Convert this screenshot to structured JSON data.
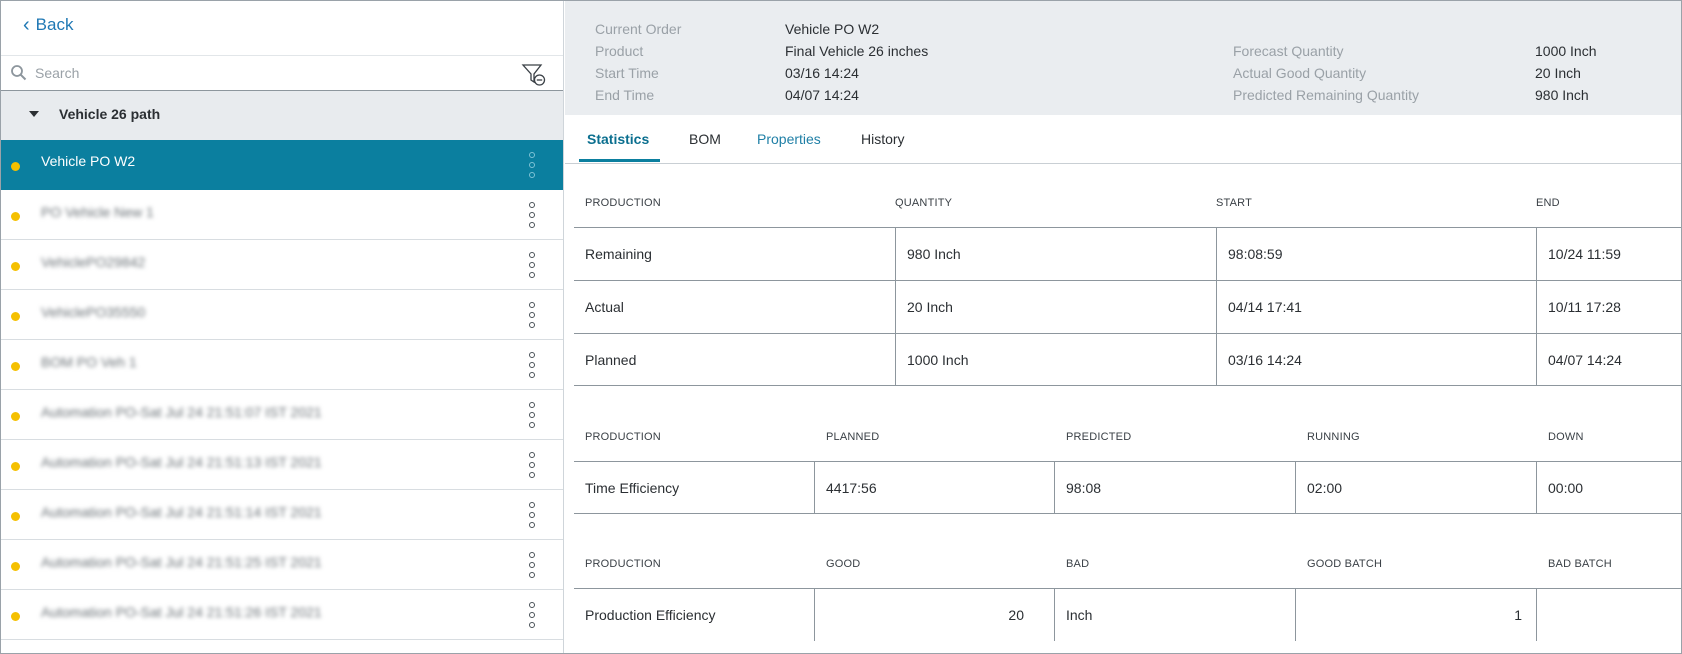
{
  "left_panel": {
    "back_label": "Back",
    "search_placeholder": "Search",
    "group_title": "Vehicle 26 path",
    "items": [
      {
        "label": "Vehicle PO W2",
        "active": true
      },
      {
        "label": "PO Vehicle New 1"
      },
      {
        "label": "VehiclePO29842"
      },
      {
        "label": "VehiclePO35550"
      },
      {
        "label": "BOM PO Veh 1"
      },
      {
        "label": "Automation PO-Sat Jul 24 21:51:07 IST 2021"
      },
      {
        "label": "Automation PO-Sat Jul 24 21:51:13 IST 2021"
      },
      {
        "label": "Automation PO-Sat Jul 24 21:51:14 IST 2021"
      },
      {
        "label": "Automation PO-Sat Jul 24 21:51:25 IST 2021"
      },
      {
        "label": "Automation PO-Sat Jul 24 21:51:26 IST 2021"
      }
    ]
  },
  "header": {
    "current_order_label": "Current Order",
    "current_order_value": "Vehicle PO W2",
    "product_label": "Product",
    "product_value": "Final Vehicle 26 inches",
    "start_time_label": "Start Time",
    "start_time_value": "03/16 14:24",
    "end_time_label": "End Time",
    "end_time_value": "04/07 14:24",
    "forecast_qty_label": "Forecast Quantity",
    "forecast_qty_value": "1000 Inch",
    "actual_good_qty_label": "Actual Good Quantity",
    "actual_good_qty_value": "20 Inch",
    "predicted_remaining_label": "Predicted Remaining Quantity",
    "predicted_remaining_value": "980 Inch"
  },
  "tabs": [
    "Statistics",
    "BOM",
    "Properties",
    "History"
  ],
  "quantity_table": {
    "headers": [
      "PRODUCTION",
      "QUANTITY",
      "START",
      "END"
    ],
    "rows": [
      [
        "Remaining",
        "980 Inch",
        "98:08:59",
        "10/24 11:59"
      ],
      [
        "Actual",
        "20 Inch",
        "04/14 17:41",
        "10/11 17:28"
      ],
      [
        "Planned",
        "1000 Inch",
        "03/16 14:24",
        "04/07 14:24"
      ]
    ]
  },
  "time_table": {
    "headers": [
      "PRODUCTION",
      "PLANNED",
      "PREDICTED",
      "RUNNING",
      "DOWN"
    ],
    "rows": [
      [
        "Time Efficiency",
        "4417:56",
        "98:08",
        "02:00",
        "00:00"
      ]
    ]
  },
  "production_table": {
    "headers": [
      "PRODUCTION",
      "GOOD",
      "BAD",
      "GOOD BATCH",
      "BAD BATCH"
    ],
    "rows": [
      [
        "Production Efficiency",
        "20",
        "Inch",
        "1",
        ""
      ]
    ]
  },
  "colors": {
    "accent": "#0b7f9f",
    "status_dot": "#f5c000",
    "header_bg": "#eaedf0",
    "link": "#1f78b4"
  }
}
